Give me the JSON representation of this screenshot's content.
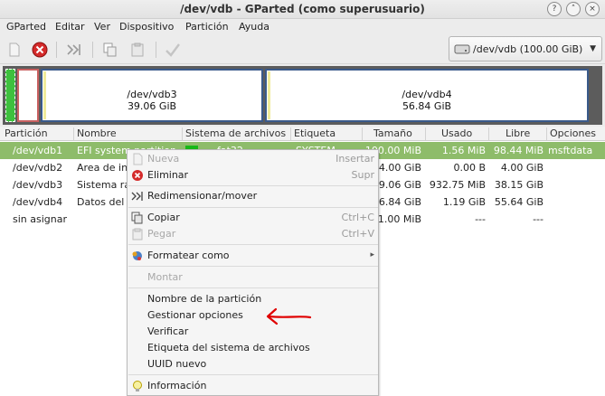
{
  "window": {
    "title": "/dev/vdb - GParted (como superusuario)"
  },
  "menubar": [
    "GParted",
    "Editar",
    "Ver",
    "Dispositivo",
    "Partición",
    "Ayuda"
  ],
  "toolbar": {
    "icons": [
      "new-icon",
      "delete-icon",
      "resize-icon",
      "copy-icon",
      "paste-icon",
      "apply-icon"
    ],
    "device": "/dev/vdb  (100.00 GiB)"
  },
  "graphic": {
    "parts": [
      {
        "name": "/dev/vdb3",
        "size": "39.06 GiB"
      },
      {
        "name": "/dev/vdb4",
        "size": "56.84 GiB"
      }
    ]
  },
  "table": {
    "headers": [
      "Partición",
      "Nombre",
      "Sistema de archivos",
      "Etiqueta",
      "Tamaño",
      "Usado",
      "Libre",
      "Opciones"
    ],
    "rows": [
      {
        "part": "/dev/vdb1",
        "name": "EFI system partition",
        "fs": "fat32",
        "label": "SYSTEM",
        "size": "100.00 MiB",
        "used": "1.56 MiB",
        "free": "98.44 MiB",
        "flags": "msftdata",
        "fscolor": "#18b818"
      },
      {
        "part": "/dev/vdb2",
        "name": "Area de in",
        "fs": "",
        "label": "",
        "size": "4.00 GiB",
        "used": "0.00 B",
        "free": "4.00 GiB",
        "flags": "",
        "fscolor": ""
      },
      {
        "part": "/dev/vdb3",
        "name": "Sistema ra",
        "fs": "",
        "label": "",
        "size": "9.06 GiB",
        "used": "932.75 MiB",
        "free": "38.15 GiB",
        "flags": "",
        "fscolor": ""
      },
      {
        "part": "/dev/vdb4",
        "name": "Datos del",
        "fs": "",
        "label": "",
        "size": "6.84 GiB",
        "used": "1.19 GiB",
        "free": "55.64 GiB",
        "flags": "",
        "fscolor": ""
      },
      {
        "part": "sin asignar",
        "name": "",
        "fs": "",
        "label": "",
        "size": "1.00 MiB",
        "used": "---",
        "free": "---",
        "flags": "",
        "fscolor": ""
      }
    ]
  },
  "menu": {
    "items": [
      {
        "label": "Nueva",
        "accel": "Insertar",
        "disabled": true,
        "icon": "new-icon"
      },
      {
        "label": "Eliminar",
        "accel": "Supr",
        "disabled": false,
        "icon": "delete-icon"
      },
      {
        "label": "Redimensionar/mover",
        "accel": "",
        "disabled": false,
        "icon": "resize-icon"
      },
      {
        "label": "Copiar",
        "accel": "Ctrl+C",
        "disabled": false,
        "icon": "copy-icon"
      },
      {
        "label": "Pegar",
        "accel": "Ctrl+V",
        "disabled": true,
        "icon": "paste-icon"
      },
      {
        "label": "Formatear como",
        "accel": "▸",
        "disabled": false,
        "icon": "format-icon"
      },
      {
        "label": "Montar",
        "accel": "",
        "disabled": true,
        "icon": ""
      },
      {
        "label": "Nombre de la partición",
        "accel": "",
        "disabled": false,
        "icon": ""
      },
      {
        "label": "Gestionar opciones",
        "accel": "",
        "disabled": false,
        "icon": ""
      },
      {
        "label": "Verificar",
        "accel": "",
        "disabled": false,
        "icon": ""
      },
      {
        "label": "Etiqueta del sistema de archivos",
        "accel": "",
        "disabled": false,
        "icon": ""
      },
      {
        "label": "UUID nuevo",
        "accel": "",
        "disabled": false,
        "icon": ""
      },
      {
        "label": "Información",
        "accel": "",
        "disabled": false,
        "icon": "info-icon"
      }
    ]
  },
  "colors": {
    "selection": "#8ebc6a",
    "fat32": "#18b818",
    "partition_border": "#3a5a8a",
    "annotation_arrow": "#e00000"
  }
}
